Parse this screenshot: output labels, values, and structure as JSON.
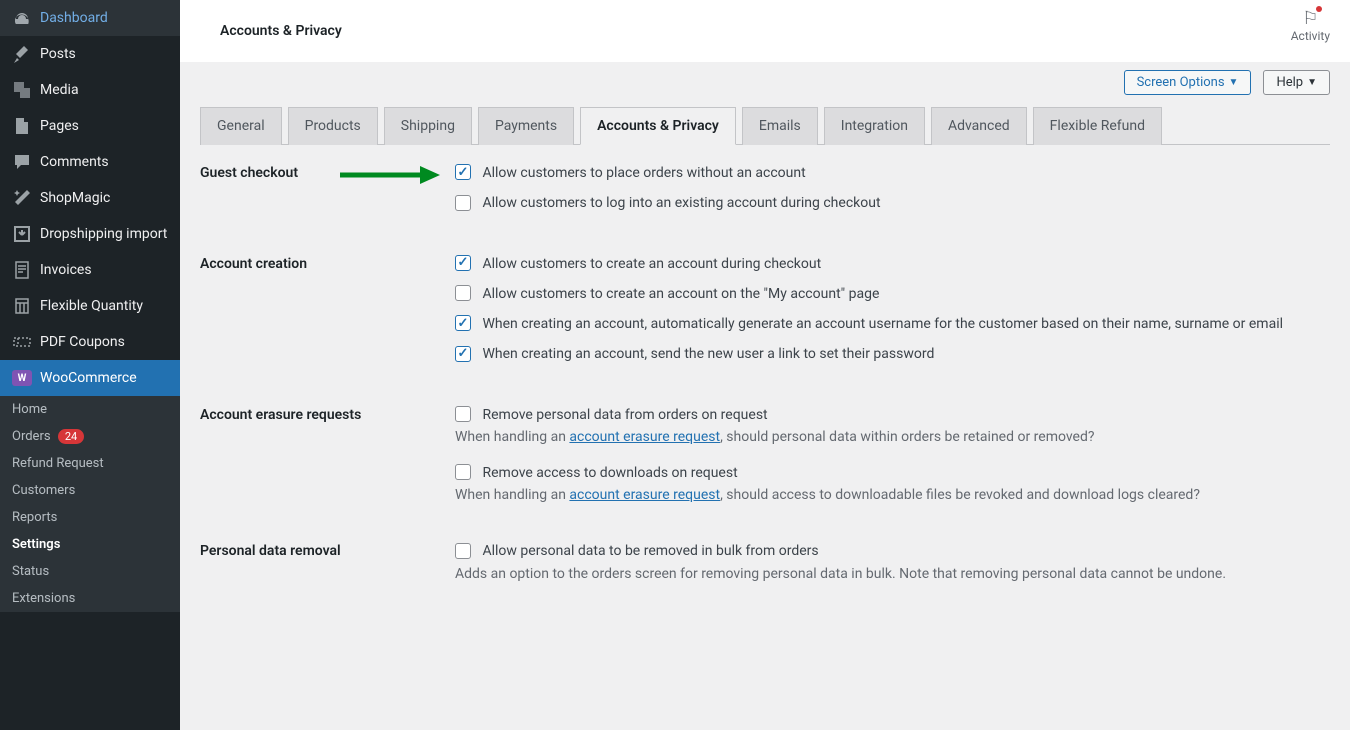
{
  "page_title": "Accounts & Privacy",
  "activity_label": "Activity",
  "screen_options": "Screen Options",
  "help": "Help",
  "sidebar": [
    {
      "label": "Dashboard",
      "icon": "dashboard"
    },
    {
      "label": "Posts",
      "icon": "pin"
    },
    {
      "label": "Media",
      "icon": "media"
    },
    {
      "label": "Pages",
      "icon": "page"
    },
    {
      "label": "Comments",
      "icon": "comment"
    },
    {
      "label": "ShopMagic",
      "icon": "wand"
    },
    {
      "label": "Dropshipping import",
      "icon": "import"
    },
    {
      "label": "Invoices",
      "icon": "invoice"
    },
    {
      "label": "Flexible Quantity",
      "icon": "calc"
    },
    {
      "label": "PDF Coupons",
      "icon": "coupon"
    },
    {
      "label": "WooCommerce",
      "icon": "woo",
      "active": true
    }
  ],
  "submenu": [
    {
      "label": "Home"
    },
    {
      "label": "Orders",
      "badge": "24"
    },
    {
      "label": "Refund Request"
    },
    {
      "label": "Customers"
    },
    {
      "label": "Reports"
    },
    {
      "label": "Settings",
      "current": true
    },
    {
      "label": "Status"
    },
    {
      "label": "Extensions"
    }
  ],
  "tabs": [
    "General",
    "Products",
    "Shipping",
    "Payments",
    "Accounts & Privacy",
    "Emails",
    "Integration",
    "Advanced",
    "Flexible Refund"
  ],
  "tabs_active": 4,
  "sections": {
    "guest_checkout": {
      "title": "Guest checkout",
      "fields": [
        {
          "label": "Allow customers to place orders without an account",
          "checked": true
        },
        {
          "label": "Allow customers to log into an existing account during checkout",
          "checked": false
        }
      ]
    },
    "account_creation": {
      "title": "Account creation",
      "fields": [
        {
          "label": "Allow customers to create an account during checkout",
          "checked": true
        },
        {
          "label": "Allow customers to create an account on the \"My account\" page",
          "checked": false
        },
        {
          "label": "When creating an account, automatically generate an account username for the customer based on their name, surname or email",
          "checked": true
        },
        {
          "label": "When creating an account, send the new user a link to set their password",
          "checked": true
        }
      ]
    },
    "account_erasure": {
      "title": "Account erasure requests",
      "fields": [
        {
          "label": "Remove personal data from orders on request",
          "checked": false,
          "desc_pre": "When handling an ",
          "desc_link": "account erasure request",
          "desc_post": ", should personal data within orders be retained or removed?"
        },
        {
          "label": "Remove access to downloads on request",
          "checked": false,
          "desc_pre": "When handling an ",
          "desc_link": "account erasure request",
          "desc_post": ", should access to downloadable files be revoked and download logs cleared?"
        }
      ]
    },
    "personal_data_removal": {
      "title": "Personal data removal",
      "fields": [
        {
          "label": "Allow personal data to be removed in bulk from orders",
          "checked": false,
          "desc": "Adds an option to the orders screen for removing personal data in bulk. Note that removing personal data cannot be undone."
        }
      ]
    }
  }
}
